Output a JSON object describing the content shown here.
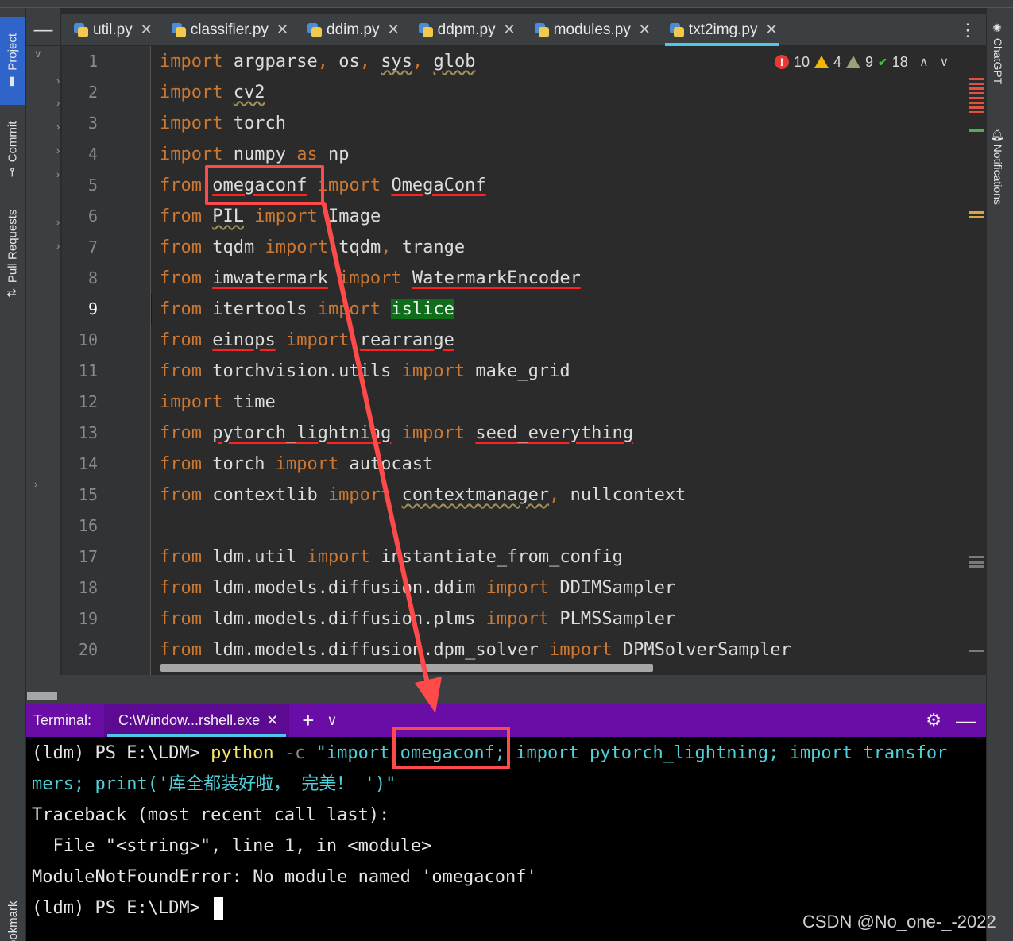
{
  "project_tabs": {
    "project": "Project",
    "commit": "Commit",
    "pull_requests": "Pull Requests",
    "bookmarks": "Bookmarks"
  },
  "right_tabs": {
    "chatgpt": "ChatGPT",
    "notifications": "Notifications"
  },
  "tabs": [
    {
      "label": "util.py",
      "active": false
    },
    {
      "label": "classifier.py",
      "active": false
    },
    {
      "label": "ddim.py",
      "active": false
    },
    {
      "label": "ddpm.py",
      "active": false
    },
    {
      "label": "modules.py",
      "active": false
    },
    {
      "label": "txt2img.py",
      "active": true
    }
  ],
  "inspections": {
    "errors": "10",
    "warnings": "4",
    "weak_warnings": "9",
    "ok": "18"
  },
  "editor": {
    "current_line": 9,
    "lines": [
      {
        "n": "1",
        "text": "import argparse, os, sys, glob"
      },
      {
        "n": "2",
        "text": "import cv2"
      },
      {
        "n": "3",
        "text": "import torch"
      },
      {
        "n": "4",
        "text": "import numpy as np"
      },
      {
        "n": "5",
        "text": "from omegaconf import OmegaConf"
      },
      {
        "n": "6",
        "text": "from PIL import Image"
      },
      {
        "n": "7",
        "text": "from tqdm import tqdm, trange"
      },
      {
        "n": "8",
        "text": "from imwatermark import WatermarkEncoder"
      },
      {
        "n": "9",
        "text": "from itertools import islice"
      },
      {
        "n": "10",
        "text": "from einops import rearrange"
      },
      {
        "n": "11",
        "text": "from torchvision.utils import make_grid"
      },
      {
        "n": "12",
        "text": "import time"
      },
      {
        "n": "13",
        "text": "from pytorch_lightning import seed_everything"
      },
      {
        "n": "14",
        "text": "from torch import autocast"
      },
      {
        "n": "15",
        "text": "from contextlib import contextmanager, nullcontext"
      },
      {
        "n": "16",
        "text": ""
      },
      {
        "n": "17",
        "text": "from ldm.util import instantiate_from_config"
      },
      {
        "n": "18",
        "text": "from ldm.models.diffusion.ddim import DDIMSampler"
      },
      {
        "n": "19",
        "text": "from ldm.models.diffusion.plms import PLMSSampler"
      },
      {
        "n": "20",
        "text": "from ldm.models.diffusion.dpm_solver import DPMSolverSampler"
      }
    ]
  },
  "terminal": {
    "title": "Terminal:",
    "tab_label": "C:\\Window...rshell.exe",
    "lines": {
      "prompt1": "(ldm) PS E:\\LDM> ",
      "cmd": "python",
      "param": " -c ",
      "str1": "\"import omegaconf; import pytorch_lightning; import transfor",
      "str2": "mers; print('库全都装好啦， 完美！ ')\"",
      "tb1": "Traceback (most recent call last):",
      "tb2": "  File \"<string>\", line 1, in <module>",
      "tb3": "ModuleNotFoundError: No module named 'omegaconf'",
      "prompt2": "(ldm) PS E:\\LDM> "
    }
  },
  "watermark": "CSDN @No_one-_-2022",
  "colors": {
    "keyword": "#cc7832",
    "error_underline": "#ff2020",
    "current_line": "#0b0f7a",
    "terminal_header": "#6a0ca6",
    "annotation": "#ff4a4a"
  }
}
